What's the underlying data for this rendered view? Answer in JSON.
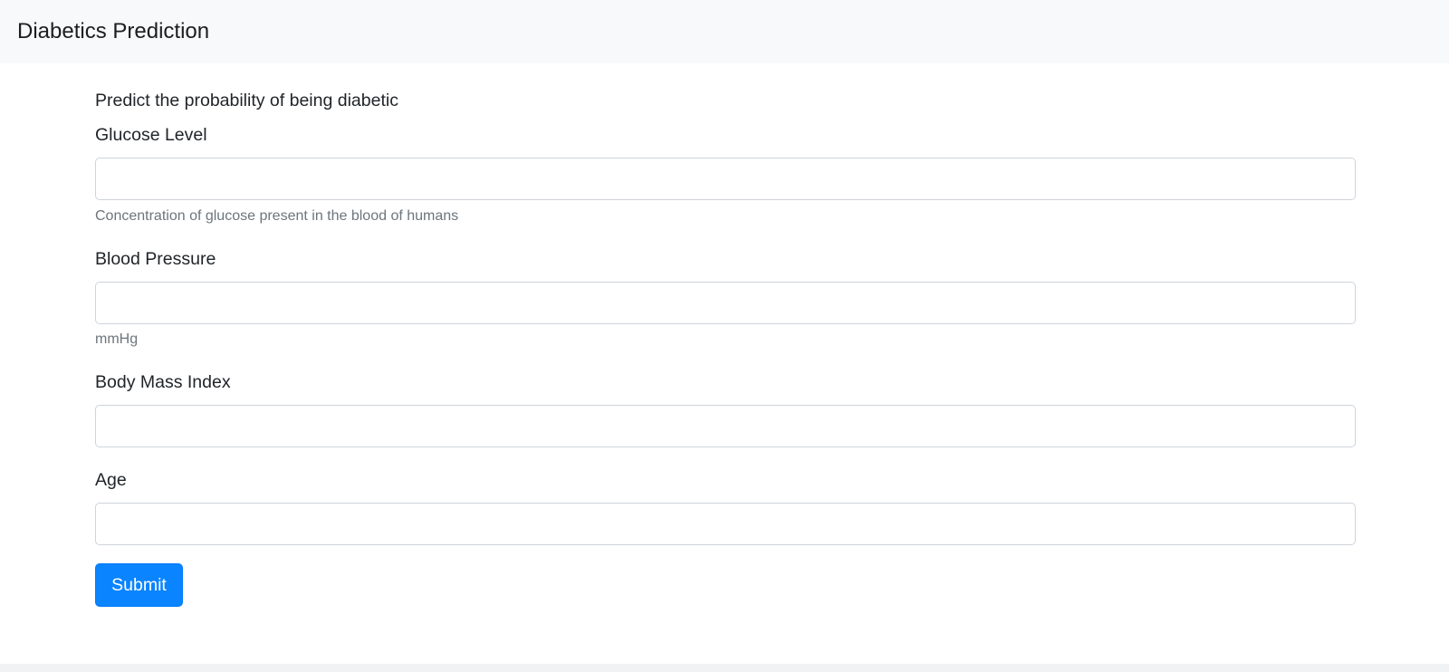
{
  "navbar": {
    "brand": "Diabetics Prediction"
  },
  "form": {
    "heading": "Predict the probability of being diabetic",
    "fields": [
      {
        "label": "Glucose Level",
        "value": "",
        "placeholder": "",
        "help": "Concentration of glucose present in the blood of humans"
      },
      {
        "label": "Blood Pressure",
        "value": "",
        "placeholder": "",
        "help": "mmHg"
      },
      {
        "label": "Body Mass Index",
        "value": "",
        "placeholder": ""
      },
      {
        "label": "Age",
        "value": "",
        "placeholder": ""
      }
    ],
    "submit_label": "Submit"
  },
  "colors": {
    "navbar_bg": "#f8f9fa",
    "primary": "#0a84ff",
    "help_text": "#6c757d",
    "input_border": "#ced4da"
  }
}
